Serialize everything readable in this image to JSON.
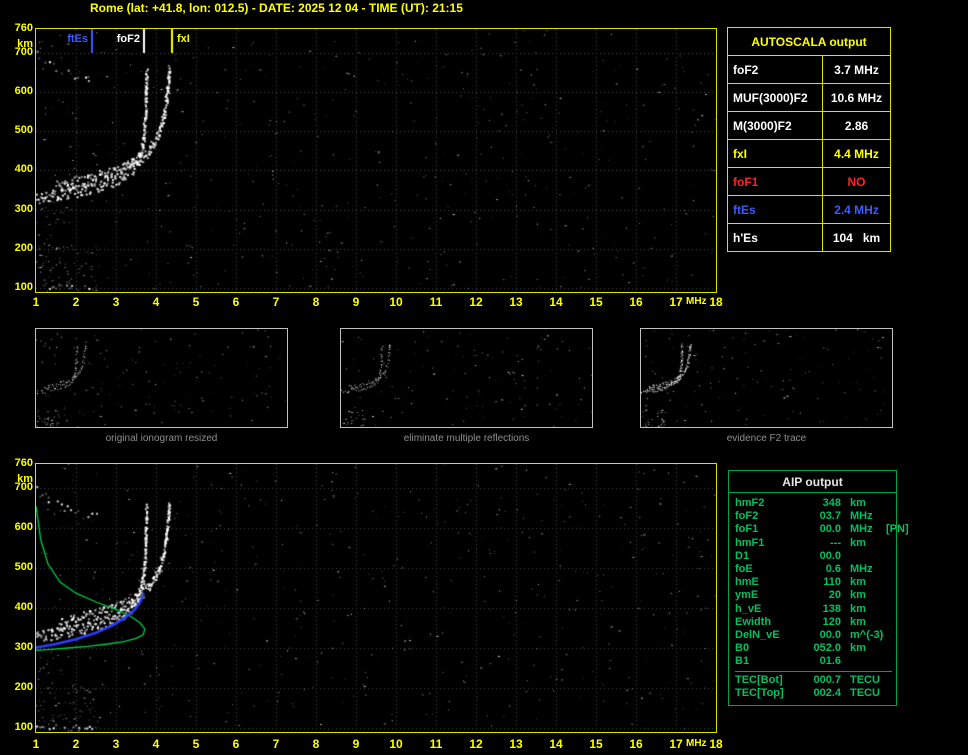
{
  "header": {
    "title": "Rome (lat: +41.8, lon: 012.5) - DATE: 2025 12 04 - TIME (UT): 21:15"
  },
  "colors": {
    "accent_yellow": "#ffff00",
    "plot_border": "#e0e000",
    "grid": "#4a4a4a",
    "trace_white": "#ffffff",
    "aip_green": "#00c060",
    "ftEs_blue": "#3a5cff",
    "foF1_red": "#ff2222",
    "caption_gray": "#8f8f8f"
  },
  "autoscala": {
    "title": "AUTOSCALA output",
    "rows": [
      {
        "param": "foF2",
        "value": "3.7 MHz",
        "color": "#ffffff"
      },
      {
        "param": "MUF(3000)F2",
        "value": "10.6 MHz",
        "color": "#ffffff"
      },
      {
        "param": "M(3000)F2",
        "value": "2.86",
        "color": "#ffffff"
      },
      {
        "param": "fxI",
        "value": "4.4 MHz",
        "color": "#ffff00"
      },
      {
        "param": "foF1",
        "value": "NO",
        "color": "#ff2222"
      },
      {
        "param": "ftEs",
        "value": "2.4 MHz",
        "color": "#3a5cff"
      },
      {
        "param": "h'Es",
        "value": "104   km",
        "color": "#ffffff"
      }
    ]
  },
  "thumbnails": [
    {
      "caption": "original ionogram resized"
    },
    {
      "caption": "eliminate multiple reflections"
    },
    {
      "caption": "evidence F2 trace"
    }
  ],
  "aip": {
    "title": "AIP output",
    "rows": [
      {
        "name": "hmF2",
        "value": "348",
        "unit": "km",
        "extra": ""
      },
      {
        "name": "foF2",
        "value": "03.7",
        "unit": "MHz",
        "extra": ""
      },
      {
        "name": "foF1",
        "value": "00.0",
        "unit": "MHz",
        "extra": "[PN]"
      },
      {
        "name": "hmF1",
        "value": "---",
        "unit": "km",
        "extra": ""
      },
      {
        "name": "D1",
        "value": "00.0",
        "unit": "",
        "extra": ""
      },
      {
        "name": "foE",
        "value": "0.6",
        "unit": "MHz",
        "extra": ""
      },
      {
        "name": "hmE",
        "value": "110",
        "unit": "km",
        "extra": ""
      },
      {
        "name": "ymE",
        "value": "20",
        "unit": "km",
        "extra": ""
      },
      {
        "name": "h_vE",
        "value": "138",
        "unit": "km",
        "extra": ""
      },
      {
        "name": "Ewidth",
        "value": "120",
        "unit": "km",
        "extra": ""
      },
      {
        "name": "DelN_vE",
        "value": "00.0",
        "unit": "m^(-3)",
        "extra": ""
      },
      {
        "name": "B0",
        "value": "052.0",
        "unit": "km",
        "extra": ""
      },
      {
        "name": "B1",
        "value": "01.6",
        "unit": "",
        "extra": ""
      },
      {
        "name": "TEC[Bot]",
        "value": "000.7",
        "unit": "TECU",
        "extra": "",
        "divider_before": true
      },
      {
        "name": "TEC[Top]",
        "value": "002.4",
        "unit": "TECU",
        "extra": ""
      }
    ]
  },
  "chart_data": {
    "type": "scatter",
    "title": "Autoscala ionogram, Rome, 2025-12-04 21:15 UT",
    "x_unit": "MHz",
    "y_unit": "km",
    "xlim": [
      1,
      18
    ],
    "ylim": [
      90,
      760
    ],
    "x_ticks": [
      1,
      2,
      3,
      4,
      5,
      6,
      7,
      8,
      9,
      10,
      11,
      12,
      13,
      14,
      15,
      16,
      17,
      18
    ],
    "y_ticks": [
      760,
      700,
      600,
      500,
      400,
      300,
      200,
      100
    ],
    "grid": "dotted",
    "legend": "none",
    "markers": [
      {
        "label": "ftEs",
        "freq": 2.4,
        "color": "#3a5cff"
      },
      {
        "label": "foF2",
        "freq": 3.7,
        "color": "#ffffff"
      },
      {
        "label": "fxI",
        "freq": 4.4,
        "color": "#ffff00"
      }
    ],
    "noise": {
      "background_count": 520,
      "bottom_left_cluster_count": 75,
      "left_edge_cluster_count": 25,
      "thumbnail_count": 130,
      "seed": 7
    },
    "series": [
      {
        "name": "F2-ordinary-trace",
        "color": "#ffffff",
        "points": [
          [
            1.0,
            333
          ],
          [
            1.4,
            337
          ],
          [
            1.8,
            343
          ],
          [
            2.2,
            352
          ],
          [
            2.6,
            363
          ],
          [
            2.9,
            374
          ],
          [
            3.2,
            390
          ],
          [
            3.4,
            406
          ],
          [
            3.52,
            425
          ],
          [
            3.62,
            452
          ],
          [
            3.68,
            490
          ],
          [
            3.72,
            545
          ],
          [
            3.74,
            610
          ],
          [
            3.75,
            650
          ]
        ]
      },
      {
        "name": "F2-extraordinary-trace",
        "color": "#ffffff",
        "points": [
          [
            1.5,
            362
          ],
          [
            1.9,
            370
          ],
          [
            2.3,
            380
          ],
          [
            2.7,
            392
          ],
          [
            3.1,
            406
          ],
          [
            3.4,
            420
          ],
          [
            3.6,
            434
          ],
          [
            3.8,
            452
          ],
          [
            3.95,
            472
          ],
          [
            4.08,
            500
          ],
          [
            4.18,
            538
          ],
          [
            4.25,
            585
          ],
          [
            4.3,
            640
          ],
          [
            4.32,
            665
          ]
        ]
      },
      {
        "name": "sporadic-E-trace",
        "color": "#ffffff",
        "points": [
          [
            1.0,
            104
          ],
          [
            1.4,
            104
          ],
          [
            1.9,
            105
          ],
          [
            2.4,
            104
          ]
        ]
      },
      {
        "name": "second-hop-trace",
        "color": "#ffffff",
        "points": [
          [
            1.0,
            697
          ],
          [
            1.3,
            672
          ],
          [
            1.6,
            654
          ],
          [
            1.95,
            642
          ],
          [
            2.3,
            636
          ],
          [
            2.6,
            640
          ]
        ]
      },
      {
        "name": "electron-density-profile",
        "color": "#00cc44",
        "plot": "bottom",
        "points": [
          [
            1.0,
            655
          ],
          [
            1.12,
            570
          ],
          [
            1.3,
            510
          ],
          [
            1.6,
            465
          ],
          [
            2.0,
            437
          ],
          [
            2.5,
            415
          ],
          [
            3.0,
            396
          ],
          [
            3.35,
            380
          ],
          [
            3.6,
            363
          ],
          [
            3.72,
            348
          ],
          [
            3.68,
            333
          ],
          [
            3.5,
            324
          ],
          [
            3.2,
            316
          ],
          [
            2.8,
            310
          ],
          [
            2.3,
            304
          ],
          [
            1.8,
            300
          ],
          [
            1.3,
            296
          ],
          [
            1.0,
            294
          ]
        ]
      },
      {
        "name": "restored-trace",
        "color": "#2b3cff",
        "plot": "bottom",
        "points": [
          [
            1.0,
            301
          ],
          [
            1.5,
            310
          ],
          [
            2.0,
            322
          ],
          [
            2.5,
            338
          ],
          [
            2.9,
            356
          ],
          [
            3.2,
            374
          ],
          [
            3.45,
            394
          ],
          [
            3.6,
            414
          ],
          [
            3.7,
            436
          ]
        ]
      }
    ],
    "panels": [
      {
        "id": "main",
        "kind": "ionogram",
        "show_markers": true,
        "show_second_hop": true
      },
      {
        "id": "thumb-0",
        "kind": "thumbnail",
        "show_second_hop": true
      },
      {
        "id": "thumb-1",
        "kind": "thumbnail",
        "show_second_hop": false
      },
      {
        "id": "thumb-2",
        "kind": "thumbnail",
        "show_second_hop": false,
        "emphasize_trace": true
      },
      {
        "id": "bottom",
        "kind": "ionogram-with-profile",
        "show_second_hop": true
      }
    ]
  }
}
